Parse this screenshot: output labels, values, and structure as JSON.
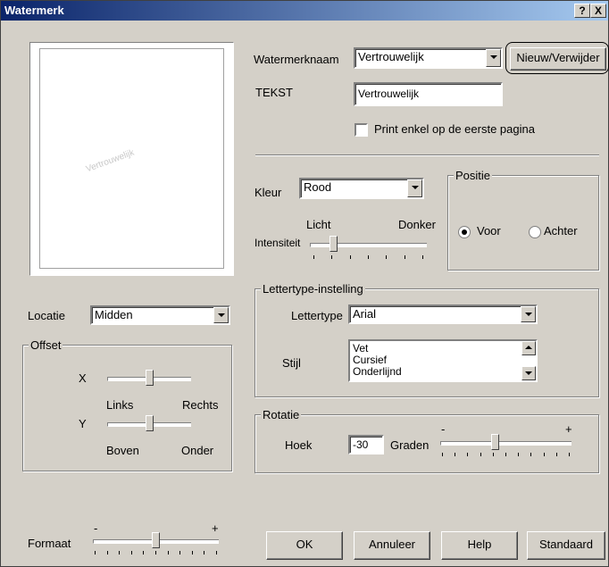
{
  "window": {
    "title": "Watermerk",
    "help": "?",
    "close": "X"
  },
  "preview": {
    "watermark_text": "Vertrouwelijk"
  },
  "watermark_name": {
    "label": "Watermerknaam",
    "value": "Vertrouwelijk",
    "new_delete_button": "Nieuw/Verwijder"
  },
  "text": {
    "label": "TEKST",
    "value": "Vertrouwelijk"
  },
  "first_page_only": {
    "label": "Print enkel op de eerste pagina",
    "checked": false
  },
  "color": {
    "label": "Kleur",
    "value": "Rood"
  },
  "intensity": {
    "label": "Intensiteit",
    "light": "Licht",
    "dark": "Donker",
    "level": 0.2
  },
  "position": {
    "title": "Positie",
    "front": "Voor",
    "back": "Achter",
    "selected": "Voor"
  },
  "font_settings": {
    "title": "Lettertype-instelling",
    "font_label": "Lettertype",
    "font_value": "Arial",
    "style_label": "Stijl",
    "styles": [
      "Vet",
      "Cursief",
      "Onderlijnd"
    ]
  },
  "rotation": {
    "title": "Rotatie",
    "angle_label": "Hoek",
    "value": "-30",
    "unit": "Graden",
    "minus": "-",
    "plus": "+",
    "level": 0.42
  },
  "location": {
    "label": "Locatie",
    "value": "Midden"
  },
  "offset": {
    "title": "Offset",
    "x_label": "X",
    "left": "Links",
    "right": "Rechts",
    "x_level": 0.5,
    "y_label": "Y",
    "top": "Boven",
    "bottom": "Onder",
    "y_level": 0.5
  },
  "size": {
    "label": "Formaat",
    "minus": "-",
    "plus": "+",
    "level": 0.5
  },
  "buttons": {
    "ok": "OK",
    "cancel": "Annuleer",
    "help": "Help",
    "default": "Standaard"
  }
}
